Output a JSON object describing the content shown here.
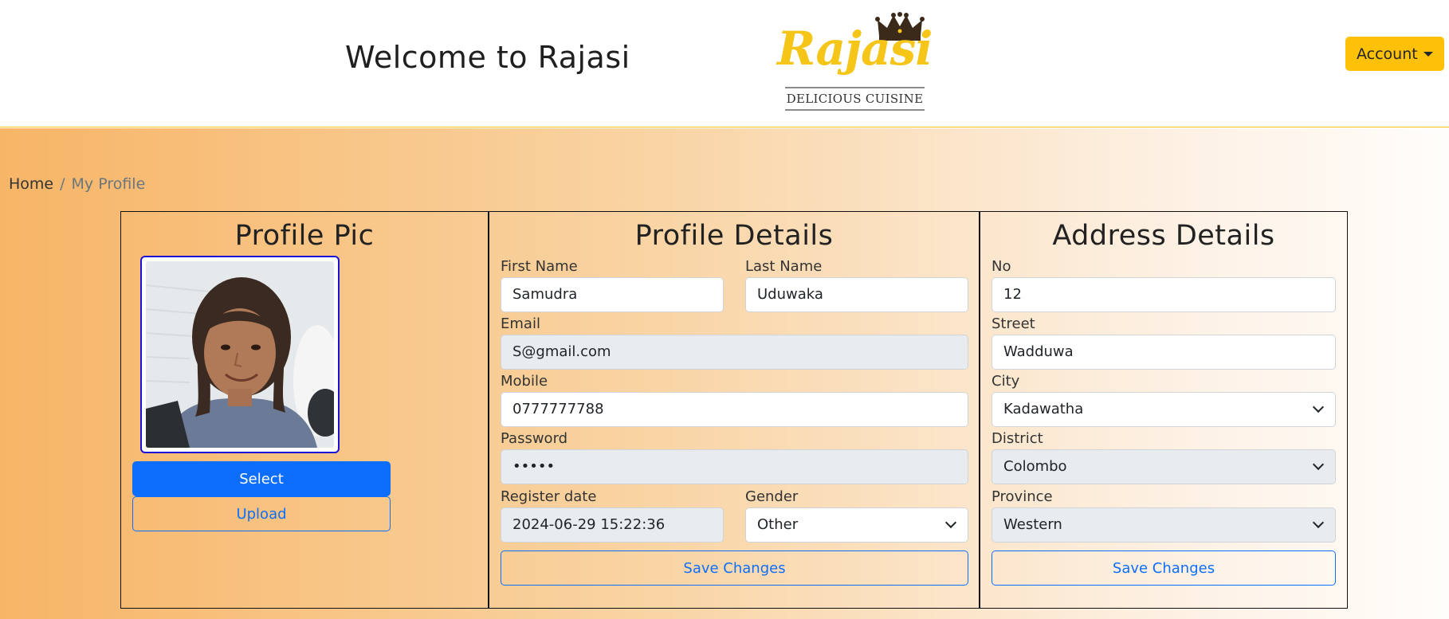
{
  "header": {
    "welcome_text": "Welcome to Rajasi",
    "logo_name": "Rajasi",
    "logo_tagline": "DELICIOUS CUISINE",
    "account_label": "Account"
  },
  "breadcrumb": {
    "home": "Home",
    "separator": "/",
    "current": "My Profile"
  },
  "profile_pic": {
    "title": "Profile Pic",
    "select_label": "Select",
    "upload_label": "Upload"
  },
  "profile_details": {
    "title": "Profile Details",
    "first_name_label": "First Name",
    "first_name_value": "Samudra",
    "last_name_label": "Last Name",
    "last_name_value": "Uduwaka",
    "email_label": "Email",
    "email_value": "S@gmail.com",
    "mobile_label": "Mobile",
    "mobile_value": "0777777788",
    "password_label": "Password",
    "password_value": "•••••",
    "register_date_label": "Register date",
    "register_date_value": "2024-06-29 15:22:36",
    "gender_label": "Gender",
    "gender_value": "Other",
    "save_label": "Save Changes"
  },
  "address_details": {
    "title": "Address Details",
    "no_label": "No",
    "no_value": "12",
    "street_label": "Street",
    "street_value": "Wadduwa",
    "city_label": "City",
    "city_value": "Kadawatha",
    "district_label": "District",
    "district_value": "Colombo",
    "province_label": "Province",
    "province_value": "Western",
    "save_label": "Save Changes"
  },
  "colors": {
    "accent_yellow": "#ffc107",
    "primary_blue": "#0d6efd",
    "gradient_start": "#f7b567",
    "gradient_end": "#fffdfb"
  }
}
